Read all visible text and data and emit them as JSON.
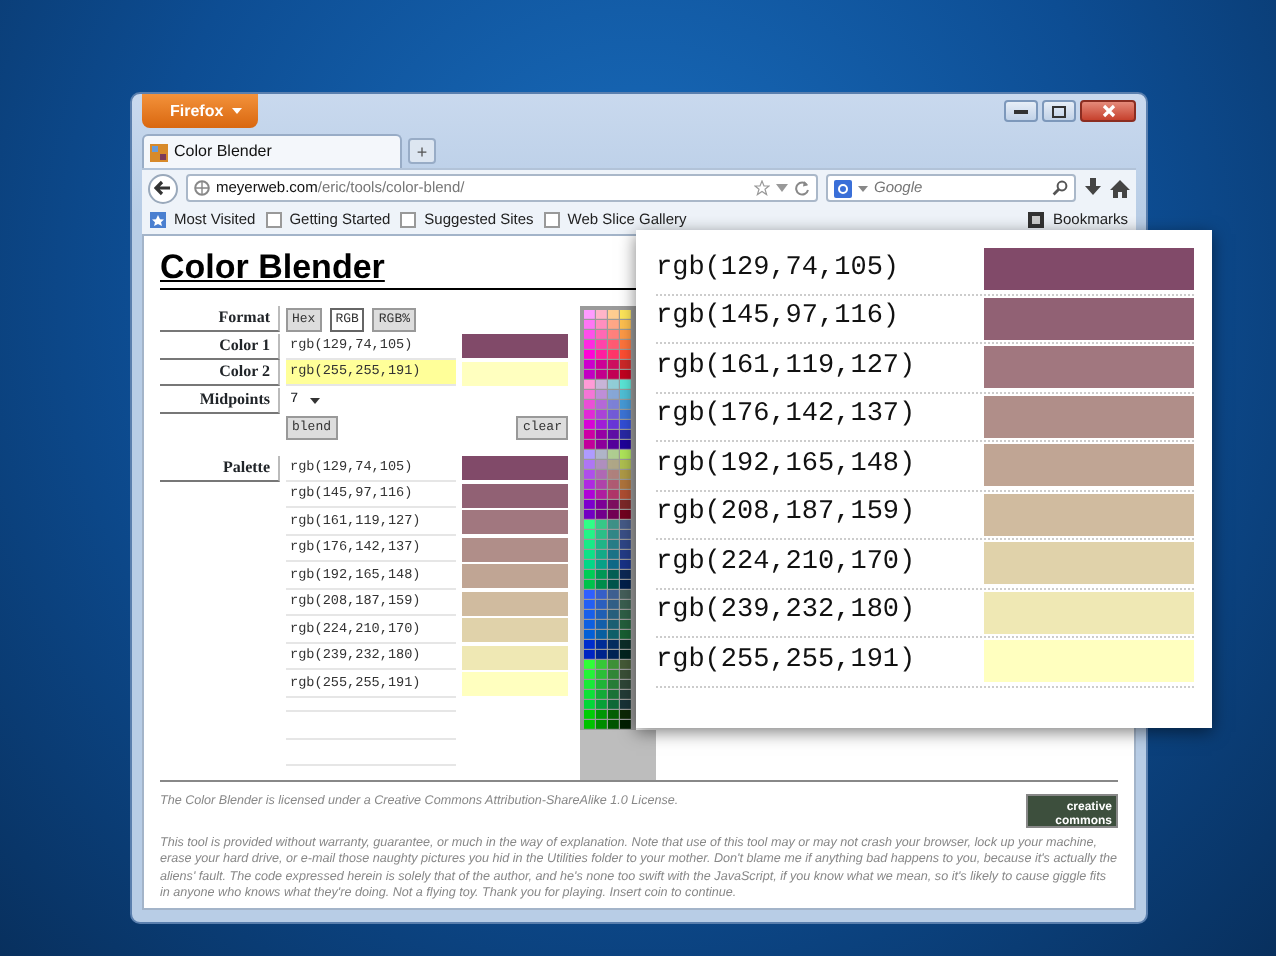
{
  "browser": {
    "menu_button": "Firefox",
    "tab": {
      "title": "Color Blender",
      "selected": true
    },
    "new_tab": "+",
    "address": {
      "host": "meyerweb.com",
      "path": "/eric/tools/color-blend/"
    },
    "search": {
      "placeholder": "Google"
    },
    "bookmarks": [
      "Most Visited",
      "Getting Started",
      "Suggested Sites",
      "Web Slice Gallery"
    ],
    "bookmarks_menu": "Bookmarks"
  },
  "page": {
    "heading": "Color Blender",
    "format": {
      "label": "Format",
      "options": [
        {
          "label": "Hex",
          "selected": false
        },
        {
          "label": "RGB",
          "selected": true
        },
        {
          "label": "RGB%",
          "selected": false
        }
      ]
    },
    "colors": [
      {
        "label": "Color 1",
        "value": "rgb(129,74,105)",
        "color": "#814a69",
        "focused": false
      },
      {
        "label": "Color 2",
        "value": "rgb(255,255,191)",
        "color": "#ffffbf",
        "focused": true
      }
    ],
    "midpoints": {
      "label": "Midpoints",
      "value": "7"
    },
    "buttons": [
      "blend",
      "clear"
    ],
    "palette": {
      "label": "Palette",
      "rows": [
        {
          "value": "rgb(129,74,105)",
          "color": "#814a69"
        },
        {
          "value": "rgb(145,97,116)",
          "color": "#916174"
        },
        {
          "value": "rgb(161,119,127)",
          "color": "#a1777f"
        },
        {
          "value": "rgb(176,142,137)",
          "color": "#b08e89"
        },
        {
          "value": "rgb(192,165,148)",
          "color": "#c0a594"
        },
        {
          "value": "rgb(208,187,159)",
          "color": "#d0bb9f"
        },
        {
          "value": "rgb(224,210,170)",
          "color": "#e0d2aa"
        },
        {
          "value": "rgb(239,232,180)",
          "color": "#efe8b4"
        },
        {
          "value": "rgb(255,255,191)",
          "color": "#ffffbf"
        }
      ]
    },
    "license": {
      "before": "The Color Blender is licensed under a Creative Commons ",
      "link": "Attribution-ShareAlike 1.0",
      "after": " License."
    },
    "cc_badge": "creative commons",
    "disclaimer": "This tool is provided without warranty, guarantee, or much in the way of explanation. Note that use of this tool may or may not crash your browser, lock up your machine, erase your hard drive, or e-mail those naughty pictures you hid in the Utilities folder to your mother. Don't blame me if anything bad happens to you, because it's actually the aliens' fault. The code expressed herein is solely that of the author, and he's none too swift with the JavaScript, if you know what we mean, so it's likely to cause giggle fits in anyone who knows what they're doing. Not a flying toy. Thank you for playing. Insert coin to continue."
  },
  "zoom_callout": {
    "rows": [
      {
        "value": "rgb(129,74,105)",
        "color": "#814a69"
      },
      {
        "value": "rgb(145,97,116)",
        "color": "#916174"
      },
      {
        "value": "rgb(161,119,127)",
        "color": "#a1777f"
      },
      {
        "value": "rgb(176,142,137)",
        "color": "#b08e89"
      },
      {
        "value": "rgb(192,165,148)",
        "color": "#c0a594"
      },
      {
        "value": "rgb(208,187,159)",
        "color": "#d0bb9f"
      },
      {
        "value": "rgb(224,210,170)",
        "color": "#e0d2aa"
      },
      {
        "value": "rgb(239,232,180)",
        "color": "#efe8b4"
      },
      {
        "value": "rgb(255,255,191)",
        "color": "#ffffbf"
      }
    ]
  }
}
